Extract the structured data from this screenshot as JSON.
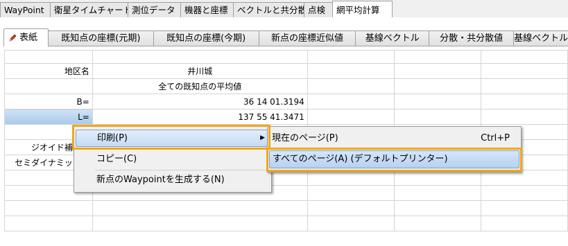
{
  "top_tabs": [
    "WayPoint",
    "衛星タイムチャート",
    "測位データ",
    "機器と座標",
    "ベクトルと共分散",
    "点検",
    "網平均計算"
  ],
  "sub_tabs": [
    "表紙",
    "既知点の座標(元期)",
    "既知点の座標(今期)",
    "新点の座標近似値",
    "基線ベクトル",
    "分散・共分散値",
    "基線ベクトル"
  ],
  "grid": {
    "rows": [
      [
        "",
        "",
        "",
        "",
        ""
      ],
      [
        "地区名",
        "井川城",
        "",
        "",
        ""
      ],
      [
        "",
        "全ての既知点の平均値",
        "",
        "",
        ""
      ],
      [
        "B=",
        "36 14 01.3194",
        "",
        "",
        ""
      ],
      [
        "L=",
        "137 55 41.3471",
        "",
        "",
        ""
      ],
      [
        "",
        "",
        "",
        "",
        ""
      ],
      [
        "ジオイド補正補",
        "",
        "",
        "",
        ""
      ],
      [
        "セミダイナミック補",
        "",
        "",
        "",
        ""
      ],
      [
        "",
        "",
        "",
        "",
        ""
      ],
      [
        "",
        "",
        "",
        "",
        ""
      ],
      [
        "",
        "",
        "",
        "",
        ""
      ],
      [
        "",
        "",
        "",
        "",
        ""
      ]
    ]
  },
  "context_menu": {
    "items": [
      "印刷(P)",
      "コピー(C)",
      "新点のWaypointを生成する(N)"
    ]
  },
  "submenu": {
    "items": [
      {
        "label": "現在のページ(P)",
        "shortcut": "Ctrl+P"
      },
      {
        "label": "すべてのページ(A) (デフォルトプリンター)",
        "shortcut": ""
      }
    ]
  },
  "colors": {
    "highlight_border": "#f0a818",
    "selection": "#a8c9ea"
  }
}
